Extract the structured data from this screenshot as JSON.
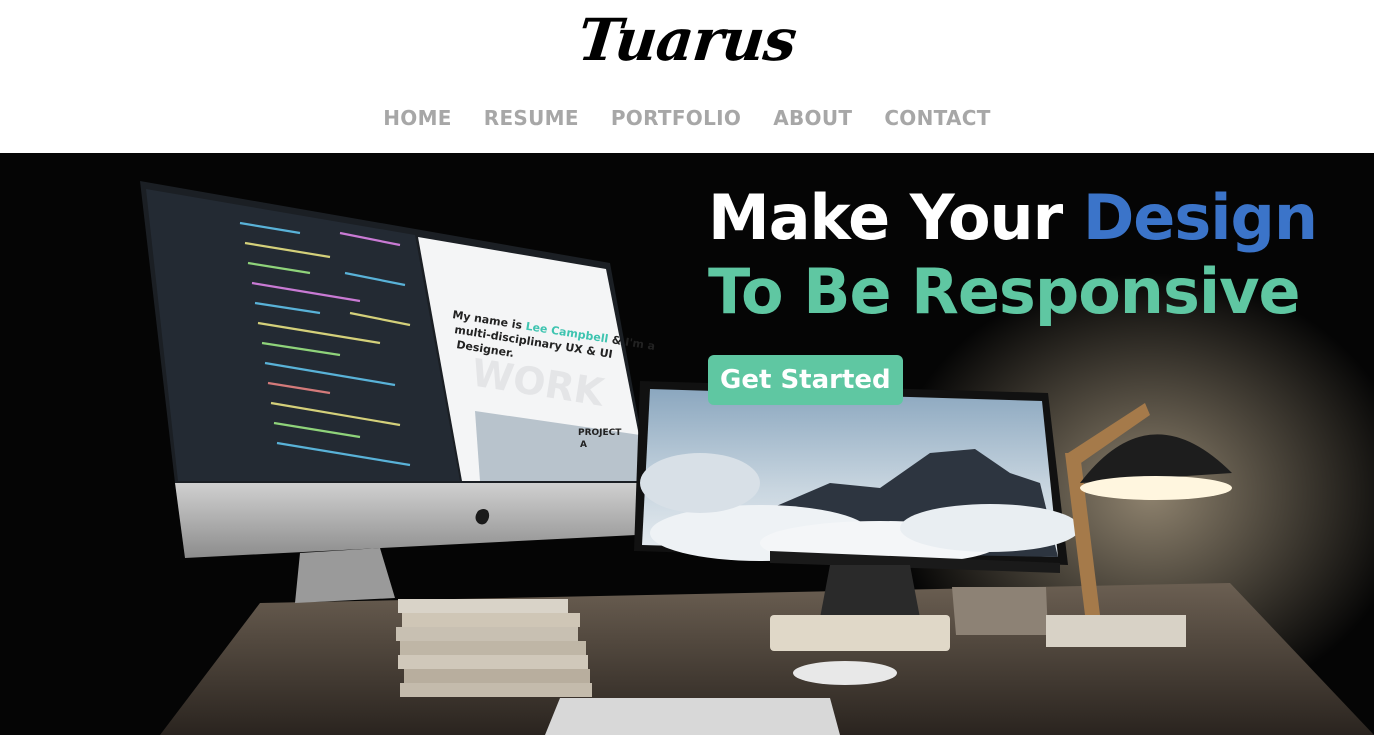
{
  "brand": {
    "logo_text": "Tuarus"
  },
  "nav": {
    "items": [
      {
        "label": "HOME"
      },
      {
        "label": "RESUME"
      },
      {
        "label": "PORTFOLIO"
      },
      {
        "label": "ABOUT"
      },
      {
        "label": "CONTACT"
      }
    ]
  },
  "hero": {
    "headline_part1": "Make Your ",
    "headline_part2": "Design",
    "headline_line2": "To Be Responsive",
    "cta_label": "Get Started",
    "screen": {
      "intro_prefix": "My name is ",
      "intro_name": "Lee Campbell",
      "intro_suffix1": " & I'm a",
      "intro_line2": "multi-disciplinary UX & UI",
      "intro_line3": "Designer.",
      "watermark": "WORK",
      "project_label": "PROJECT",
      "project_letter": "A"
    }
  },
  "colors": {
    "accent_blue": "#3b74c9",
    "accent_green": "#5fc7a2",
    "nav_gray": "#a7a7a7"
  }
}
